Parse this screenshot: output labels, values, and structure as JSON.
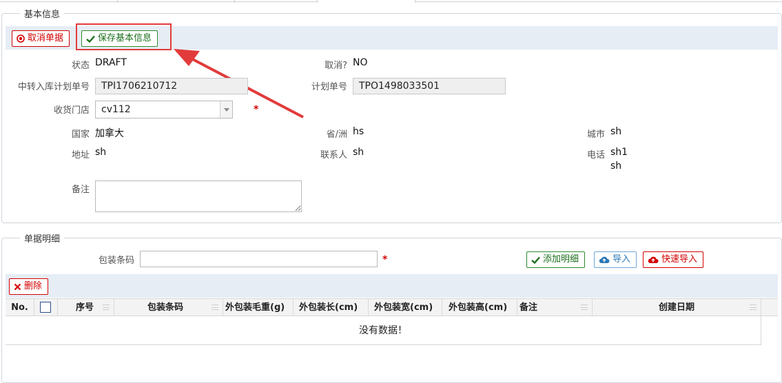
{
  "basic_info": {
    "legend": "基本信息",
    "toolbar": {
      "cancel_label": "取消单据",
      "save_label": "保存基本信息"
    },
    "fields": {
      "status_label": "状态",
      "status_value": "DRAFT",
      "cancelled_label": "取消?",
      "cancelled_value": "NO",
      "transfer_plan_label": "中转入库计划单号",
      "transfer_plan_value": "TPI1706210712",
      "plan_no_label": "计划单号",
      "plan_no_value": "TPO1498033501",
      "store_label": "收货门店",
      "store_value": "cv112",
      "required_mark": "*",
      "country_label": "国家",
      "country_value": "加拿大",
      "province_label": "省/洲",
      "province_value": "hs",
      "city_label": "城市",
      "city_value": "sh",
      "address_label": "地址",
      "address_value": "sh",
      "contact_label": "联系人",
      "contact_value": "sh",
      "phone_label": "电话",
      "phone_value_1": "sh1",
      "phone_value_2": "sh",
      "remark_label": "备注",
      "remark_value": ""
    }
  },
  "detail": {
    "legend": "单据明细",
    "barcode_label": "包装条码",
    "barcode_value": "",
    "required_mark": "*",
    "add_label": "添加明细",
    "import_label": "导入",
    "quick_import_label": "快速导入",
    "delete_label": "删除",
    "columns": [
      "No.",
      "序号",
      "包装条码",
      "外包装毛重(g)",
      "外包装长(cm)",
      "外包装宽(cm)",
      "外包装高(cm)",
      "备注",
      "创建日期"
    ],
    "empty_text": "没有数据！"
  },
  "colors": {
    "red": "#d40000",
    "green": "#2e8b2e",
    "blue": "#2a78b6",
    "annotation": "#e23b3b"
  },
  "icons": [
    "cancel-circle-icon",
    "checkmark-icon",
    "cloud-upload-icon",
    "close-x-icon"
  ]
}
